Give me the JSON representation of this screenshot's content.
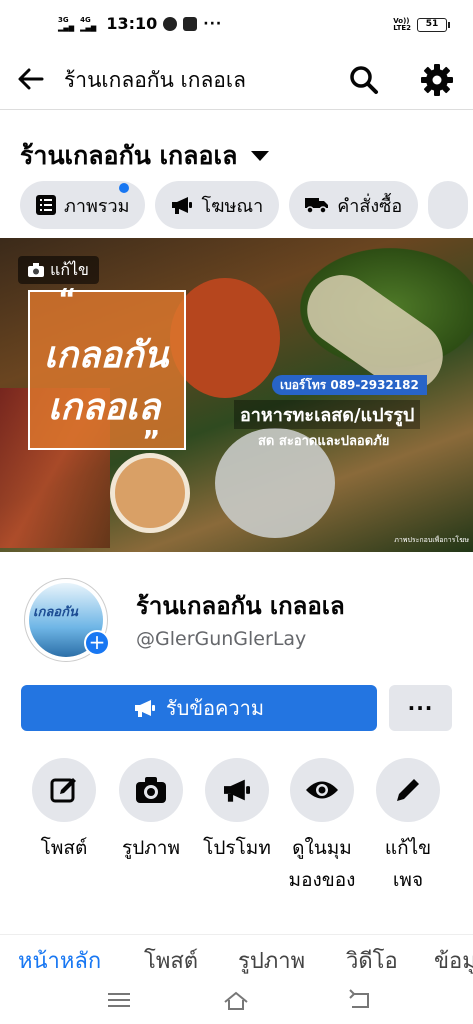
{
  "status_bar": {
    "net1": "3G",
    "net2": "4G",
    "time": "13:10",
    "dots": "···",
    "volte_top": "Vo))",
    "volte_bottom": "LTE2",
    "battery": "51"
  },
  "top_bar": {
    "title": "ร้านเกลอกัน เกลอเล",
    "icons": [
      "back-arrow-icon",
      "search-icon",
      "gear-icon"
    ]
  },
  "page_header": {
    "name": "ร้านเกลอกัน เกลอเล"
  },
  "chips": [
    {
      "label": "ภาพรวม",
      "icon": "overview-list-icon",
      "has_dot": true
    },
    {
      "label": "โฆษณา",
      "icon": "megaphone-icon",
      "has_dot": false
    },
    {
      "label": "คำสั่งซื้อ",
      "icon": "truck-icon",
      "has_dot": false
    }
  ],
  "cover": {
    "edit_label": "แก้ไข",
    "logo_line1": "เกลอกัน",
    "logo_line2": "เกลอเล",
    "quote_open": "“",
    "quote_close": "”",
    "phone": "เบอร์โทร 089-2932182",
    "headline": "อาหารทะเลสด/แปรรูป",
    "subline": "สด สะอาดและปลอดภัย",
    "footnote": "ภาพประกอบเพื่อการโฆษ"
  },
  "profile": {
    "avatar_text": "เกลอกัน",
    "name": "ร้านเกลอกัน เกลอเล",
    "handle": "@GlerGunGlerLay",
    "add_symbol": "+"
  },
  "buttons": {
    "message_label": "รับข้อความ",
    "more_label": "···"
  },
  "actions": [
    {
      "line1": "โพสต์",
      "line2": "",
      "icon": "compose-icon"
    },
    {
      "line1": "รูปภาพ",
      "line2": "",
      "icon": "camera-icon"
    },
    {
      "line1": "โปรโมท",
      "line2": "",
      "icon": "megaphone-icon"
    },
    {
      "line1": "ดูในมุม",
      "line2": "มองของ",
      "icon": "eye-icon"
    },
    {
      "line1": "แก้ไข",
      "line2": "เพจ",
      "icon": "pencil-icon"
    }
  ],
  "tabs": [
    {
      "label": "หน้าหลัก",
      "active": true
    },
    {
      "label": "โพสต์",
      "active": false
    },
    {
      "label": "รูปภาพ",
      "active": false
    },
    {
      "label": "วิดีโอ",
      "active": false
    },
    {
      "label": "ข้อมู",
      "active": false
    }
  ],
  "colors": {
    "accent": "#1877f2",
    "button_blue": "#2375e1",
    "chip_bg": "#e4e6eb",
    "secondary_text": "#65676b"
  }
}
